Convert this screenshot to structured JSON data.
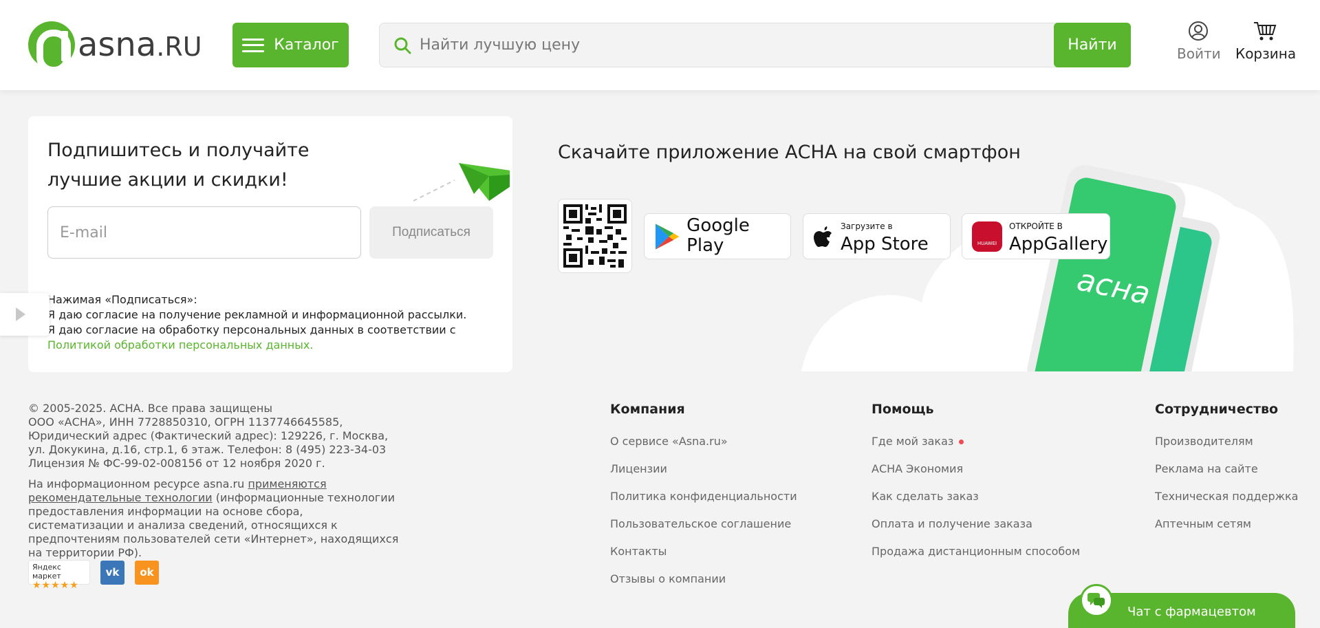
{
  "header": {
    "logo_text": "asna",
    "logo_suffix": ".RU",
    "catalog_label": "Каталог",
    "search_placeholder": "Найти лучшую цену",
    "search_button": "Найти",
    "login_label": "Войти",
    "cart_label": "Корзина"
  },
  "subscribe": {
    "title": "Подпишитесь и получайте лучшие акции и скидки!",
    "email_placeholder": "E-mail",
    "button": "Подписаться",
    "consent_line1": "Нажимая «Подписаться»:",
    "consent_line2": "Я даю согласие на получение рекламной и информационной рассылки.",
    "consent_line3": "Я даю согласие на обработку персональных данных в соответствии с",
    "consent_link": "Политикой обработки персональных данных."
  },
  "app": {
    "title": "Скачайте приложение АСНА на свой смартфон",
    "google_play": "Google Play",
    "app_store_small": "Загрузите в",
    "app_store": "App Store",
    "appgallery_small": "ОТКРОЙТЕ В",
    "appgallery": "AppGallery",
    "huawei": "HUAWEI",
    "phone_brand": "асна"
  },
  "footer": {
    "copyright": "© 2005-2025. АСНА. Все права защищены",
    "company_info": "ООО «АСНА», ИНН 7728850310, ОГРН 1137746645585, Юридический адрес (Фактический адрес): 129226, г. Москва, ул. Докукина, д.16, стр.1, 6 этаж. Телефон: 8 (495) 223-34-03",
    "license": "Лицензия № ФС-99-02-008156 от 12 ноября 2020 г.",
    "recommend_prefix": "На информационном ресурсе asna.ru",
    "recommend_link": "применяются рекомендательные технологии",
    "recommend_suffix": "(информационные технологии предоставления информации на основе сбора, систематизации и анализа сведений, относящихся к предпочтениям пользователей сети «Интернет», находящихся на территории РФ).",
    "ym_label": "Яндекс маркет",
    "ym_stars": "★★★★★",
    "vk": "vk",
    "ok": "ok",
    "columns": [
      {
        "title": "Компания",
        "links": [
          "О сервисе «Asna.ru»",
          "Лицензии",
          "Политика конфиденциальности",
          "Пользовательское соглашение",
          "Контакты",
          "Отзывы о компании"
        ]
      },
      {
        "title": "Помощь",
        "links": [
          "Где мой заказ",
          "АСНА Экономия",
          "Как сделать заказ",
          "Оплата и получение заказа",
          "Продажа дистанционным способом"
        ]
      },
      {
        "title": "Сотрудничество",
        "links": [
          "Производителям",
          "Реклама на сайте",
          "Техническая поддержка",
          "Аптечным сетям"
        ]
      }
    ]
  },
  "chat": {
    "label": "Чат с фармацевтом"
  },
  "colors": {
    "brand_green": "#5ab52e",
    "notice_dot": "#f04b55"
  }
}
